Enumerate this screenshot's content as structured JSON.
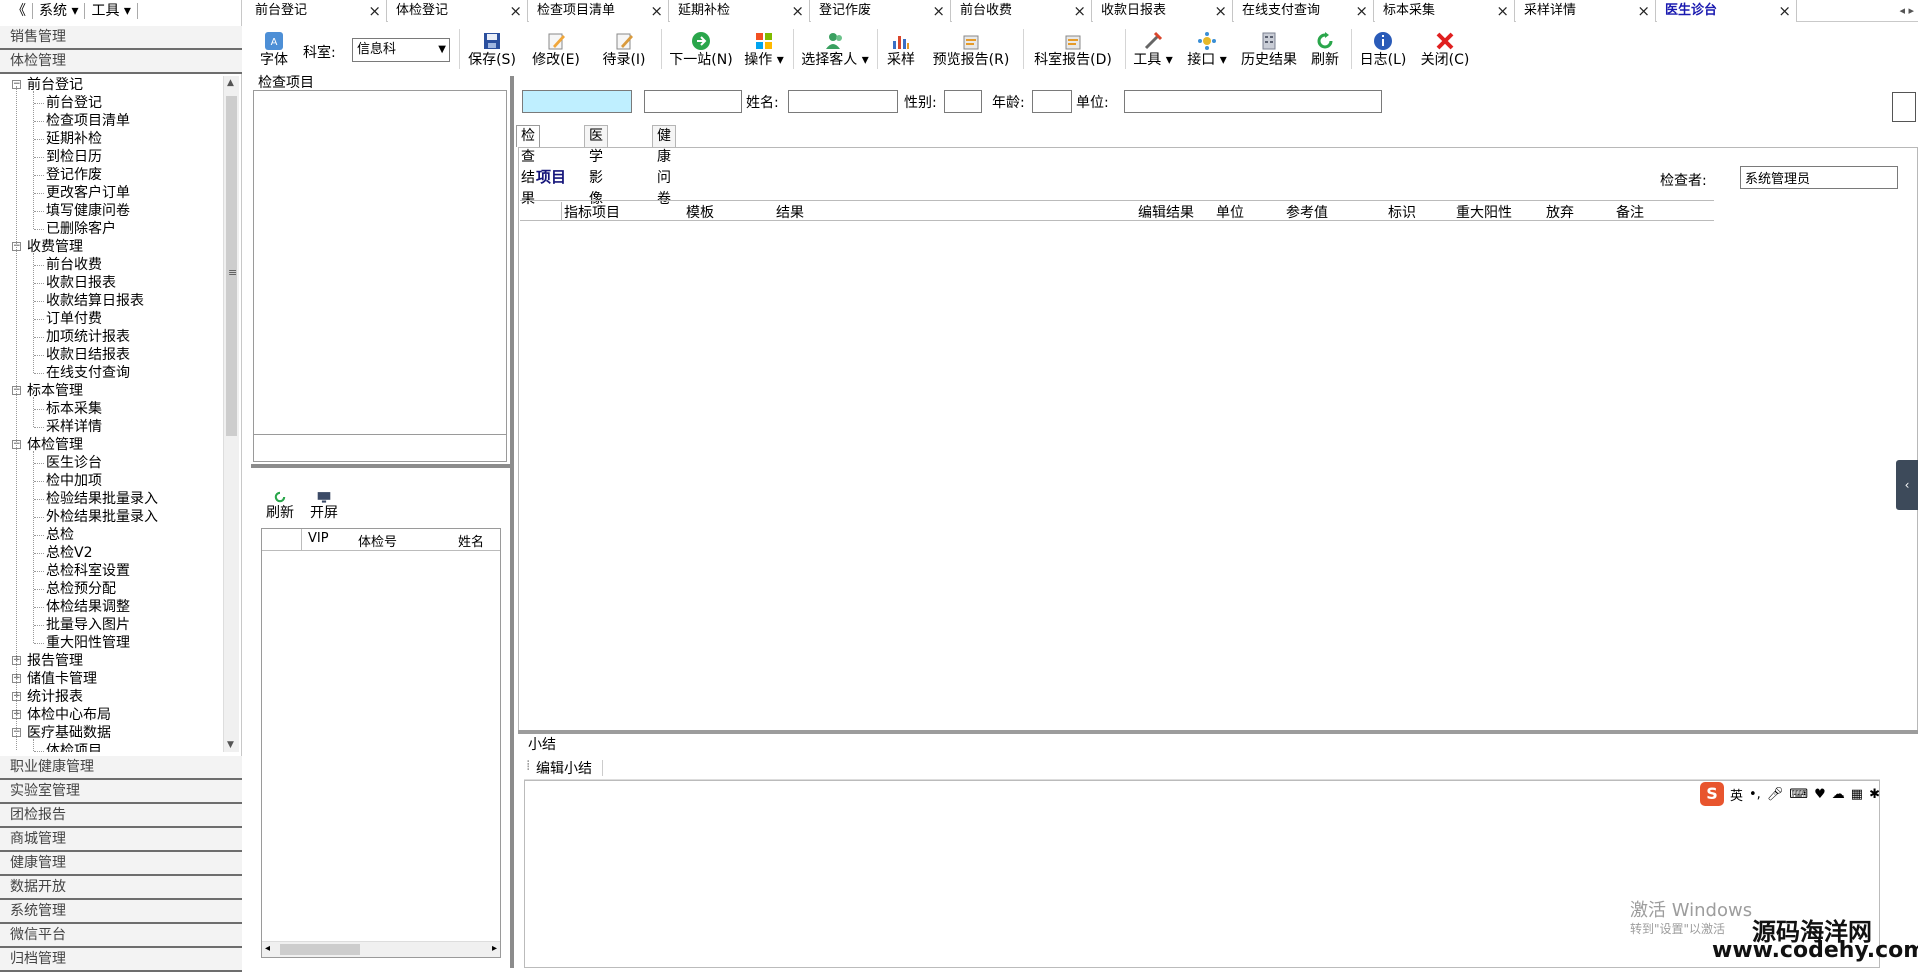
{
  "top_menu": {
    "collapse": "《",
    "system": "系统",
    "tools": "工具"
  },
  "nav_groups_top": [
    "销售管理",
    "体检管理"
  ],
  "tree": [
    {
      "label": "前台登记",
      "expanded": true,
      "children": [
        "前台登记",
        "检查项目清单",
        "延期补检",
        "到检日历",
        "登记作废",
        "更改客户订单",
        "填写健康问卷",
        "已删除客户"
      ]
    },
    {
      "label": "收费管理",
      "expanded": true,
      "children": [
        "前台收费",
        "收款日报表",
        "收款结算日报表",
        "订单付费",
        "加项统计报表",
        "收款日结报表",
        "在线支付查询"
      ]
    },
    {
      "label": "标本管理",
      "expanded": true,
      "children": [
        "标本采集",
        "采样详情"
      ]
    },
    {
      "label": "体检管理",
      "expanded": true,
      "children": [
        "医生诊台",
        "检中加项",
        "检验结果批量录入",
        "外检结果批量录入",
        "总检",
        "总检V2",
        "总检科室设置",
        "总检预分配",
        "体检结果调整",
        "批量导入图片",
        "重大阳性管理"
      ]
    },
    {
      "label": "报告管理",
      "expanded": false,
      "children": []
    },
    {
      "label": "储值卡管理",
      "expanded": false,
      "children": []
    },
    {
      "label": "统计报表",
      "expanded": false,
      "children": []
    },
    {
      "label": "体检中心布局",
      "expanded": false,
      "children": []
    },
    {
      "label": "医疗基础数据",
      "expanded": true,
      "children": [
        "体检项目"
      ]
    }
  ],
  "nav_groups_bottom": [
    "职业健康管理",
    "实验室管理",
    "团检报告",
    "商城管理",
    "健康管理",
    "数据开放",
    "系统管理",
    "微信平台",
    "归档管理"
  ],
  "tabs": [
    {
      "label": "前台登记",
      "active": false
    },
    {
      "label": "体检登记",
      "active": false
    },
    {
      "label": "检查项目清单",
      "active": false
    },
    {
      "label": "延期补检",
      "active": false
    },
    {
      "label": "登记作废",
      "active": false
    },
    {
      "label": "前台收费",
      "active": false
    },
    {
      "label": "收款日报表",
      "active": false
    },
    {
      "label": "在线支付查询",
      "active": false
    },
    {
      "label": "标本采集",
      "active": false
    },
    {
      "label": "采样详情",
      "active": false
    },
    {
      "label": "医生诊台",
      "active": true
    }
  ],
  "toolbar": {
    "font": "字体",
    "dept_label": "科室:",
    "dept_value": "信息科",
    "save": "保存(S)",
    "modify": "修改(E)",
    "pending": "待录(I)",
    "next_station": "下一站(N)",
    "operate": "操作",
    "select_guest": "选择客人",
    "sampling": "采样",
    "preview_report": "预览报告(R)",
    "dept_report": "科室报告(D)",
    "tools": "工具",
    "interface": "接口",
    "history": "历史结果",
    "refresh": "刷新",
    "log": "日志(L)",
    "close": "关闭(C)"
  },
  "left_panel": {
    "items_label": "检查项目",
    "refresh": "刷新",
    "open_screen": "开屏",
    "grid_columns": [
      "VIP",
      "体检号",
      "姓名"
    ]
  },
  "patient_form": {
    "name_label": "姓名:",
    "gender_label": "性别:",
    "age_label": "年龄:",
    "company_label": "单位:"
  },
  "sub_tabs": [
    "检查结果",
    "医学影像",
    "健康问卷"
  ],
  "results": {
    "section_title": "项目",
    "checker_label": "检查者:",
    "checker_value": "系统管理员",
    "columns": [
      "指标项目",
      "模板",
      "结果",
      "编辑结果",
      "单位",
      "参考值",
      "标识",
      "重大阳性",
      "放弃",
      "备注"
    ]
  },
  "summary": {
    "label": "小结",
    "edit_button": "编辑小结"
  },
  "ime": {
    "logo": "S",
    "lang": "英"
  },
  "watermarks": {
    "activate": "激活 Windows",
    "activate_hint": "转到\"设置\"以激活",
    "brand_cn": "源码海洋网",
    "brand_url": "www.codehy.com"
  },
  "colors": {
    "active_tab": "#1a1ab0",
    "section_title": "#14147a",
    "focus_input": "#bfefff",
    "save_icon": "#2a4f9e",
    "refresh_icon": "#2aa64b",
    "close_icon": "#e01f1f"
  }
}
